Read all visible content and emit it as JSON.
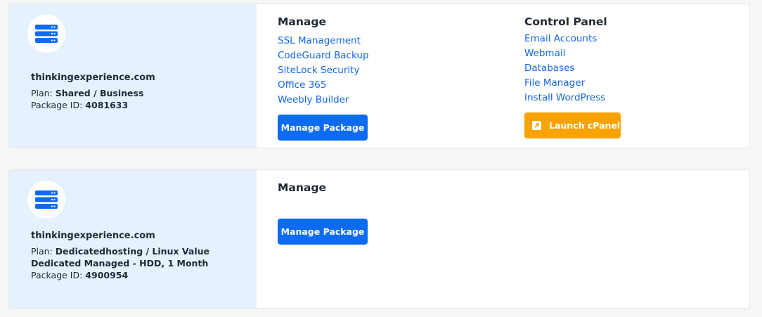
{
  "accent": "#0b6bf5",
  "link_color": "#1668e3",
  "cpanel_color": "#f9a300",
  "panel_bg": "#e5f1fd",
  "packages": [
    {
      "domain": "thinkingexperience.com",
      "plan_label": "Plan:",
      "plan_value": "Shared / Business",
      "package_id_label": "Package ID:",
      "package_id": "4081633",
      "manage": {
        "title": "Manage",
        "links": [
          "SSL Management",
          "CodeGuard Backup",
          "SiteLock Security",
          "Office 365",
          "Weebly Builder"
        ],
        "button": "Manage Package"
      },
      "control_panel": {
        "title": "Control Panel",
        "links": [
          "Email Accounts",
          "Webmail",
          "Databases",
          "File Manager",
          "Install WordPress"
        ],
        "button": "Launch cPanel",
        "button_icon": "external-link-icon"
      }
    },
    {
      "domain": "thinkingexperience.com",
      "plan_label": "Plan:",
      "plan_value_line1": "Dedicatedhosting / Linux Value",
      "plan_value_line2": "Dedicated Managed - HDD, 1 Month",
      "package_id_label": "Package ID:",
      "package_id": "4900954",
      "manage": {
        "title": "Manage",
        "button": "Manage Package"
      }
    }
  ],
  "icons": {
    "server": "server-icon"
  }
}
